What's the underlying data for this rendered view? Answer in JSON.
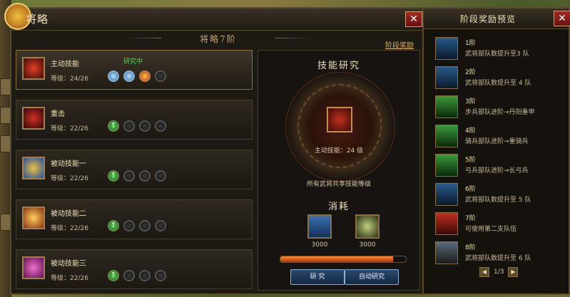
{
  "main": {
    "title": "将略",
    "subtitle": "将略7阶",
    "stage_link": "阶段奖励"
  },
  "skills": [
    {
      "name": "主动技能",
      "level": "等级：24/26",
      "status": "研究中",
      "icon": "warrior-attack-icon"
    },
    {
      "name": "重击",
      "level": "等级：22/26",
      "icon": "heavy-strike-icon"
    },
    {
      "name": "被动技能一",
      "level": "等级：22/26",
      "icon": "passive-skill-icon"
    },
    {
      "name": "被动技能二",
      "level": "等级：22/26",
      "icon": "passive-skill-icon"
    },
    {
      "name": "被动技能三",
      "level": "等级：22/26",
      "icon": "passive-skill-icon"
    }
  ],
  "research": {
    "title": "技能研究",
    "skill_text": "主动技能：24 级",
    "desc": "所有武将共享技能等级",
    "cost_title": "消耗",
    "cost1": "3000",
    "cost2": "3000",
    "progress": 0.9,
    "btn_research": "研 究",
    "btn_auto": "自动研究"
  },
  "rewards": {
    "title": "阶段奖励预览",
    "items": [
      {
        "tier": "1阶",
        "text": "武将部队数提升至3 队"
      },
      {
        "tier": "2阶",
        "text": "武将部队数提升至 4 队"
      },
      {
        "tier": "3阶",
        "text": "步兵部队进阶→丹阳重甲"
      },
      {
        "tier": "4阶",
        "text": "骑兵部队进阶→重骑兵"
      },
      {
        "tier": "5阶",
        "text": "弓兵部队进阶→长弓兵"
      },
      {
        "tier": "6阶",
        "text": "武将部队数提升至 5 队"
      },
      {
        "tier": "7阶",
        "text": "可使用第二支队伍"
      },
      {
        "tier": "8阶",
        "text": "武将部队数提升至 6 队"
      }
    ],
    "page": "1/3"
  },
  "colors": {
    "accent": "#f0e0b8",
    "green": "#60d060",
    "button": "#2a4a70"
  }
}
